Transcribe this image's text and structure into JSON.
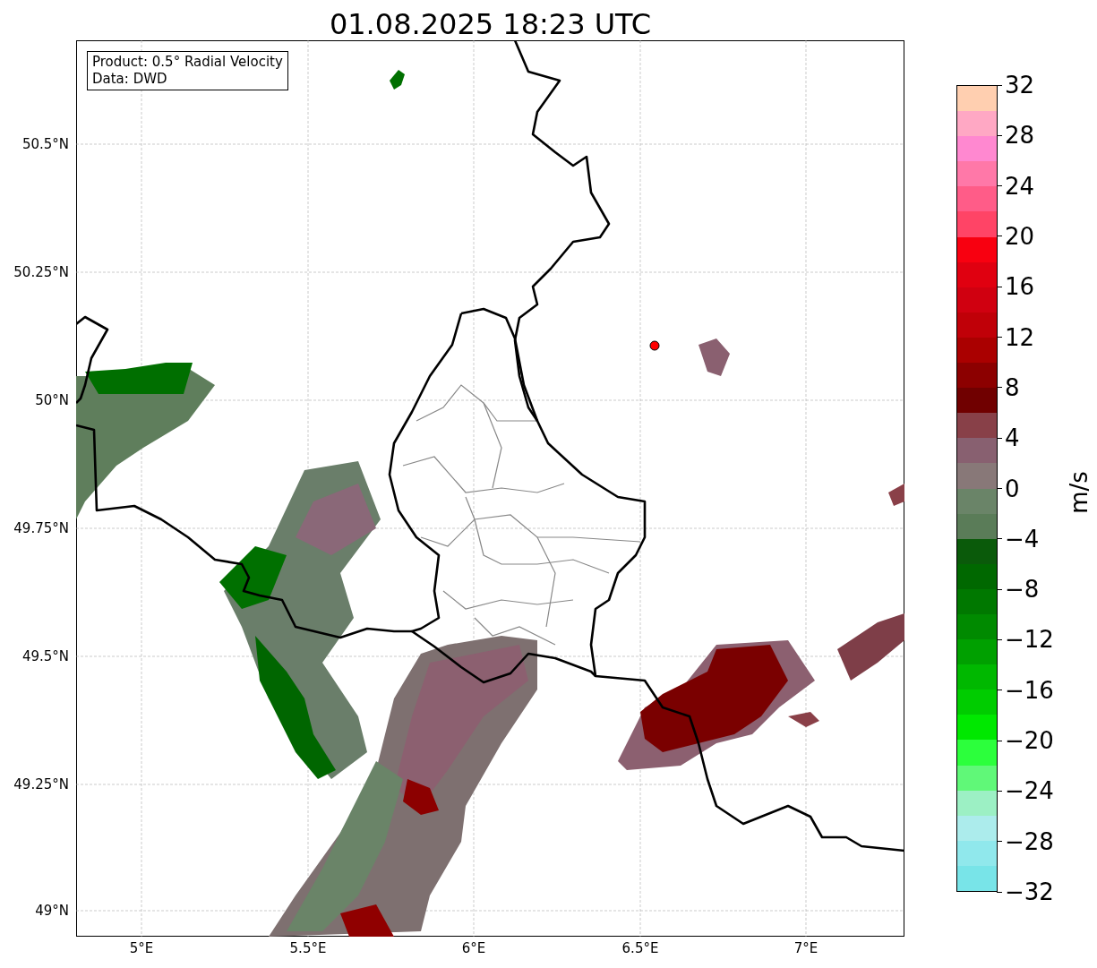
{
  "title": "01.08.2025 18:23 UTC",
  "info_box": [
    "Product: 0.5° Radial Velocity",
    "Data: DWD"
  ],
  "map": {
    "y_ticks": [
      "50.5°N",
      "50.25°N",
      "50°N",
      "49.75°N",
      "49.5°N",
      "49.25°N",
      "49°N"
    ],
    "x_ticks": [
      "5°E",
      "5.5°E",
      "6°E",
      "6.5°E",
      "7°E"
    ]
  },
  "colorbar": {
    "label": "m/s",
    "ticks": [
      "32",
      "28",
      "24",
      "20",
      "16",
      "12",
      "8",
      "4",
      "0",
      "−4",
      "−8",
      "−12",
      "−16",
      "−20",
      "−24",
      "−28",
      "−32"
    ],
    "segments": [
      {
        "color": "#ffcfb0"
      },
      {
        "color": "#ffa8c4"
      },
      {
        "color": "#ff88d0"
      },
      {
        "color": "#ff78a8"
      },
      {
        "color": "#ff5c88"
      },
      {
        "color": "#ff4466"
      },
      {
        "color": "#f80010"
      },
      {
        "color": "#e00010"
      },
      {
        "color": "#d00010"
      },
      {
        "color": "#c00008"
      },
      {
        "color": "#aa0000"
      },
      {
        "color": "#8c0000"
      },
      {
        "color": "#700000"
      },
      {
        "color": "#884048"
      },
      {
        "color": "#886070"
      },
      {
        "color": "#887878"
      },
      {
        "color": "#6a8468"
      },
      {
        "color": "#5a7c58"
      },
      {
        "color": "#0a5a0a"
      },
      {
        "color": "#006800"
      },
      {
        "color": "#007800"
      },
      {
        "color": "#008a00"
      },
      {
        "color": "#00a000"
      },
      {
        "color": "#00b800"
      },
      {
        "color": "#00cc00"
      },
      {
        "color": "#00e800"
      },
      {
        "color": "#2cff3c"
      },
      {
        "color": "#60f878"
      },
      {
        "color": "#9cf0c4"
      },
      {
        "color": "#acecec"
      },
      {
        "color": "#90e8ec"
      },
      {
        "color": "#78e4e8"
      }
    ]
  }
}
